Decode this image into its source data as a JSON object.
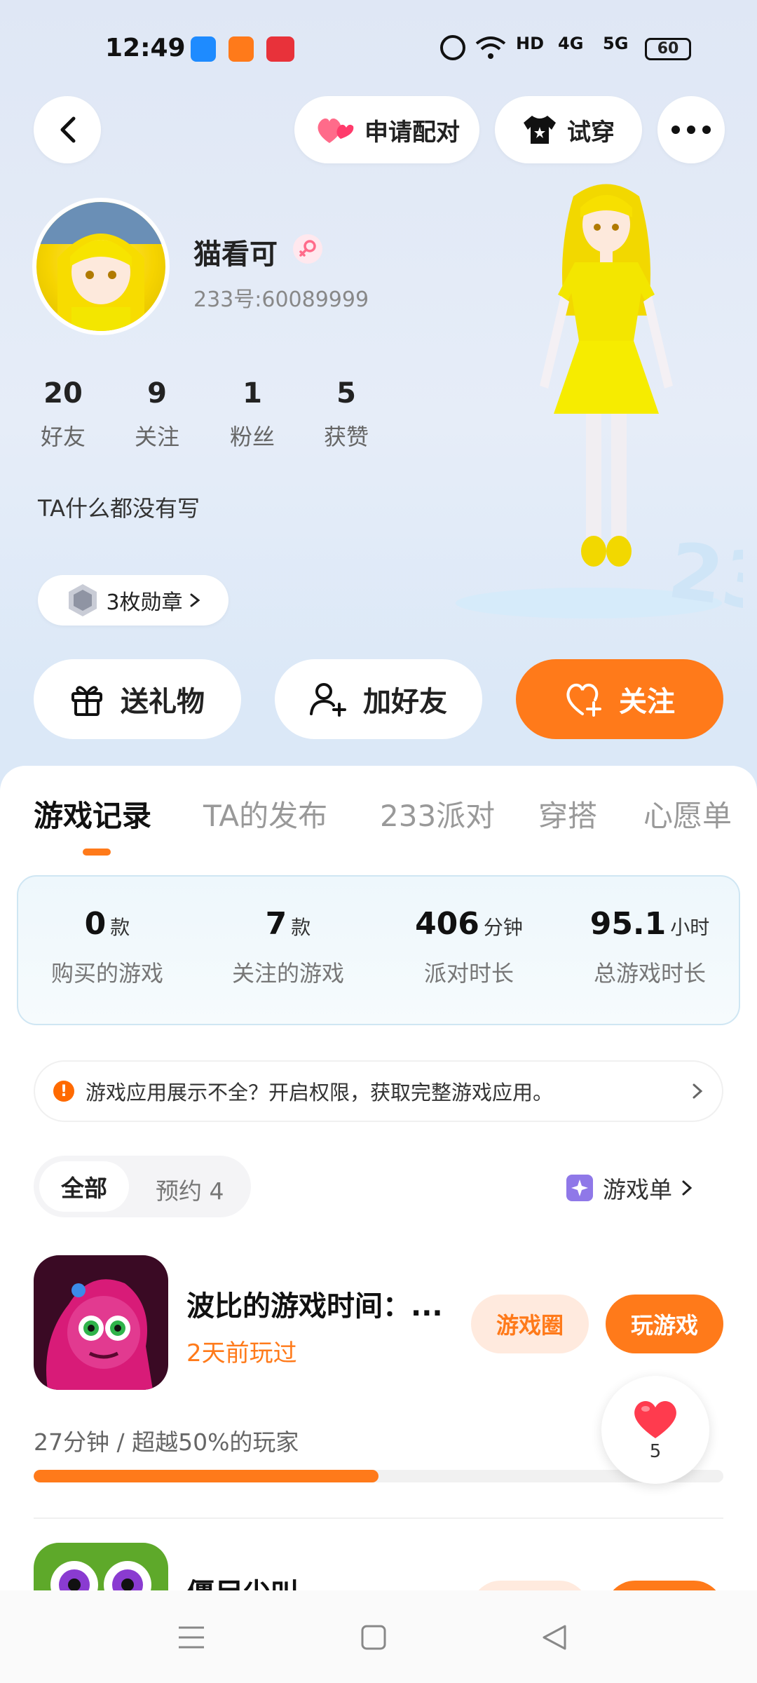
{
  "status_bar": {
    "time": "12:49",
    "battery": "60",
    "signal_labels": [
      "HD",
      "4G",
      "5G"
    ]
  },
  "header": {
    "pair_label": "申请配对",
    "try_label": "试穿"
  },
  "profile": {
    "nickname": "猫看可",
    "uid": "233号:60089999",
    "bio": "TA什么都没有写",
    "medal_label": "3枚勋章",
    "stats": [
      {
        "value": "20",
        "label": "好友"
      },
      {
        "value": "9",
        "label": "关注"
      },
      {
        "value": "1",
        "label": "粉丝"
      },
      {
        "value": "5",
        "label": "获赞"
      }
    ]
  },
  "actions": {
    "gift": "送礼物",
    "add_friend": "加好友",
    "follow": "关注"
  },
  "tabs": [
    "游戏记录",
    "TA的发布",
    "233派对",
    "穿搭",
    "心愿单"
  ],
  "summary": [
    {
      "value": "0",
      "unit": "款",
      "label": "购买的游戏"
    },
    {
      "value": "7",
      "unit": "款",
      "label": "关注的游戏"
    },
    {
      "value": "406",
      "unit": "分钟",
      "label": "派对时长"
    },
    {
      "value": "95.1",
      "unit": "小时",
      "label": "总游戏时长"
    }
  ],
  "notice": "游戏应用展示不全？开启权限，获取完整游戏应用。",
  "filters": {
    "all": "全部",
    "reserved": "预约 4",
    "game_list": "游戏单"
  },
  "games": [
    {
      "title": "波比的游戏时间：...",
      "last_played": "2天前玩过",
      "circle_label": "游戏圈",
      "play_label": "玩游戏",
      "stat": "27分钟 / 超越50%的玩家",
      "progress": 0.5,
      "likes": "5"
    },
    {
      "title": "僵尸尖叫"
    }
  ],
  "colors": {
    "accent": "#ff7a1a",
    "like": "#ff3b4e"
  }
}
